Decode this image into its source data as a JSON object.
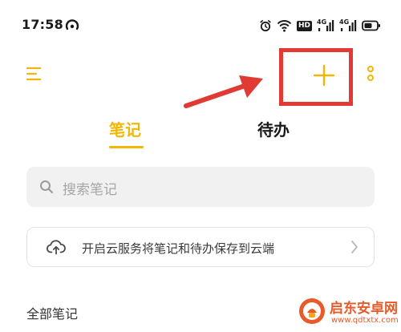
{
  "status_bar": {
    "time": "17:58",
    "hd_label": "HD",
    "signal_1": "4G",
    "signal_2": "4G"
  },
  "toolbar": {
    "menu_icon": "menu-icon",
    "add_icon": "plus-icon",
    "more_icon": "more-vertical-icon"
  },
  "tabs": [
    {
      "label": "笔记",
      "active": true
    },
    {
      "label": "待办",
      "active": false
    }
  ],
  "search": {
    "placeholder": "搜索笔记"
  },
  "cloud_banner": {
    "text": "开启云服务将笔记和待办保存到云端"
  },
  "section": {
    "title": "全部笔记"
  },
  "watermark": {
    "name": "启东安卓网",
    "url": "www.qdtxtx.com"
  },
  "colors": {
    "accent": "#f2b705",
    "annotation_red": "#e03a33",
    "search_bg": "#f1f1f1",
    "watermark": "#e85a2a"
  }
}
